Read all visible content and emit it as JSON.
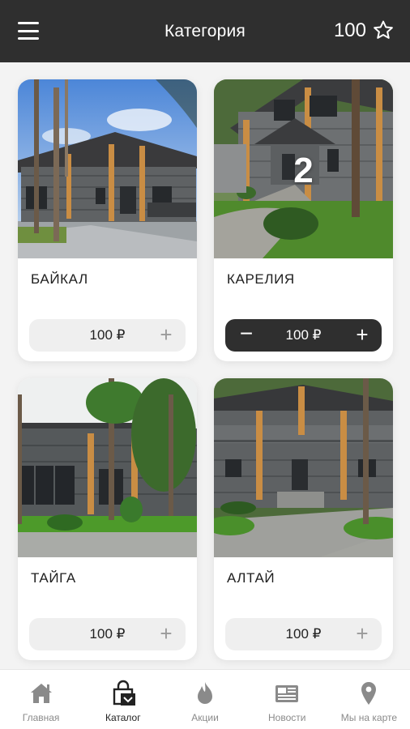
{
  "header": {
    "title": "Категория",
    "points": "100",
    "menu_icon": "menu-icon",
    "star_icon": "star-outline-icon"
  },
  "cards": [
    {
      "name": "БАЙКАЛ",
      "price": "100 ₽",
      "quantity": "",
      "in_cart": false,
      "image": "log-house-photo"
    },
    {
      "name": "КАРЕЛИЯ",
      "price": "100 ₽",
      "quantity": "2",
      "in_cart": true,
      "image": "log-house-photo"
    },
    {
      "name": "ТАЙГА",
      "price": "100 ₽",
      "quantity": "",
      "in_cart": false,
      "image": "log-house-photo"
    },
    {
      "name": "АЛТАЙ",
      "price": "100 ₽",
      "quantity": "",
      "in_cart": false,
      "image": "log-house-photo"
    }
  ],
  "controls": {
    "minus": "−",
    "plus": "+"
  },
  "bottom_nav": {
    "items": [
      {
        "label": "Главная",
        "icon": "home-icon",
        "active": false
      },
      {
        "label": "Каталог",
        "icon": "shopping-bag-icon",
        "active": true
      },
      {
        "label": "Акции",
        "icon": "flame-icon",
        "active": false
      },
      {
        "label": "Новости",
        "icon": "newspaper-icon",
        "active": false
      },
      {
        "label": "Мы на карте",
        "icon": "map-pin-icon",
        "active": false
      }
    ]
  },
  "colors": {
    "header_bg": "#2f2f2f",
    "active_control_bg": "#2f2f2f",
    "nav_inactive": "#8a8a8a",
    "nav_active": "#222222"
  }
}
